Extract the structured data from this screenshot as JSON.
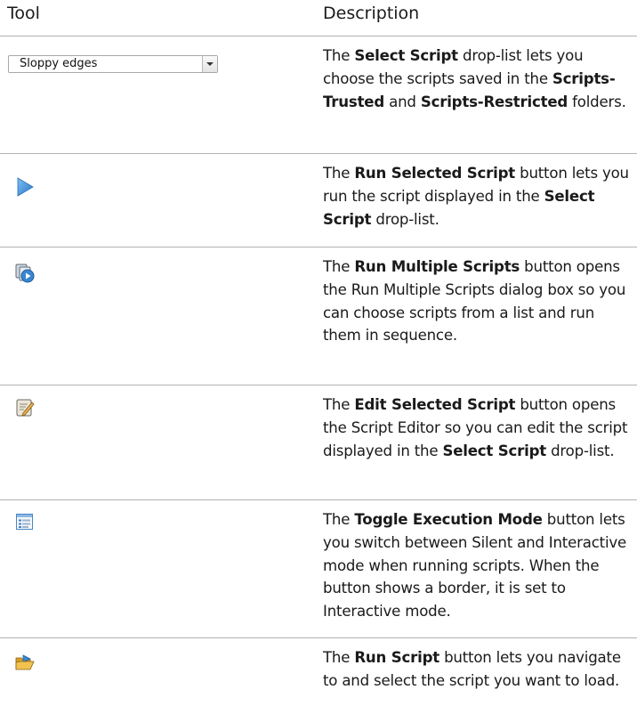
{
  "header": {
    "tool": "Tool",
    "description": "Description"
  },
  "rows": [
    {
      "p1": "The ",
      "b1": "Select Script",
      "p2": " drop-list lets you choose the scripts saved in the ",
      "b2": "Scripts-Trusted",
      "p3": " and ",
      "b3": "Scripts-Restricted",
      "p4": " folders."
    },
    {
      "p1": "The ",
      "b1": "Run Selected Script",
      "p2": " button lets you run the script displayed in the ",
      "b2": "Select Script",
      "p3": " drop-list."
    },
    {
      "p1": "The ",
      "b1": "Run Multiple Scripts",
      "p2": " button opens the Run Multiple Scripts dialog box so you can choose scripts from a list and run them in sequence."
    },
    {
      "p1": "The ",
      "b1": "Edit Selected Script",
      "p2": " button opens the Script Editor so you can edit the script displayed in the ",
      "b2": "Select Script",
      "p3": " drop-list."
    },
    {
      "p1": "The ",
      "b1": "Toggle Execution Mode",
      "p2": " button lets you switch between Silent and Interactive mode when running scripts. When the button shows a border, it is set to Interactive mode."
    },
    {
      "p1": "The ",
      "b1": "Run Script",
      "p2": " button lets you navigate to and select the script you want to load."
    }
  ],
  "dropdown": {
    "value": "Sloppy edges"
  },
  "icons": [
    "play-triangle-icon",
    "multiple-scripts-icon",
    "edit-script-icon",
    "execution-mode-icon",
    "open-folder-icon"
  ],
  "colors": {
    "rule": "#b3b3b3",
    "play": "#3f8fd6"
  }
}
